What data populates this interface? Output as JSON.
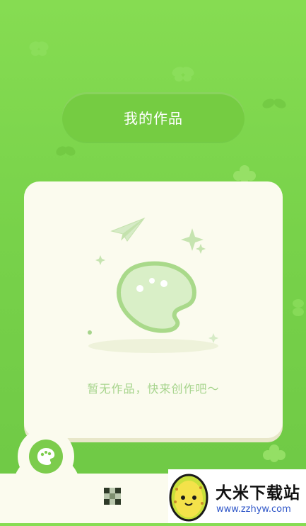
{
  "header": {
    "title": "我的作品"
  },
  "empty_state": {
    "message": "暂无作品，快来创作吧～"
  },
  "fab": {
    "icon": "palette-icon"
  },
  "bottom_nav": {
    "grid_icon": "grid-icon"
  },
  "watermark": {
    "title": "大米下载站",
    "url": "www.zzhyw.com"
  },
  "colors": {
    "background": "#7fd64c",
    "card": "#fbfbee",
    "accent_green": "#7ccc4c",
    "muted_green": "#a6d48c"
  }
}
